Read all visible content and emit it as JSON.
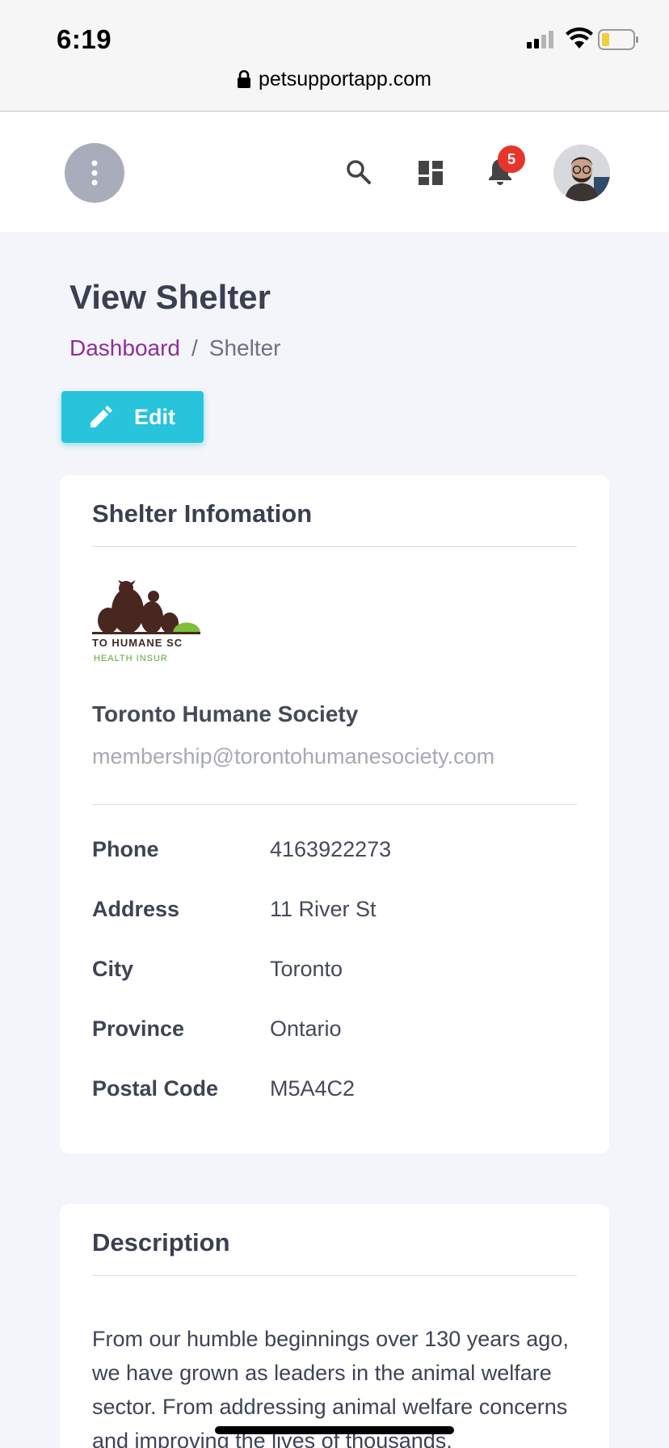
{
  "status_bar": {
    "time": "6:19",
    "url": "petsupportapp.com"
  },
  "header": {
    "menu_icon": "more-vertical-icon",
    "icons": [
      "search-icon",
      "dashboard-icon",
      "bell-icon"
    ],
    "notification_count": "5",
    "avatar_icon": "user-avatar"
  },
  "page": {
    "title": "View Shelter",
    "breadcrumb": {
      "link": "Dashboard",
      "separator": "/",
      "current": "Shelter"
    },
    "edit_label": "Edit"
  },
  "shelter_card": {
    "title": "Shelter Infomation",
    "logo_text_line1": "TO HUMANE SC",
    "logo_text_line2": "HEALTH INSUR",
    "name": "Toronto Humane Society",
    "email": "membership@torontohumanesociety.com",
    "details": [
      {
        "label": "Phone",
        "value": "4163922273"
      },
      {
        "label": "Address",
        "value": "11 River St"
      },
      {
        "label": "City",
        "value": "Toronto"
      },
      {
        "label": "Province",
        "value": "Ontario"
      },
      {
        "label": "Postal Code",
        "value": "M5A4C2"
      }
    ]
  },
  "description_card": {
    "title": "Description",
    "text": "From our humble beginnings over 130 years ago, we have grown as leaders in the animal welfare sector. From addressing animal welfare concerns and improving the lives of thousands,"
  },
  "colors": {
    "accent_link": "#8e2f9c",
    "edit_button": "#27c4dc",
    "badge": "#e8352c",
    "background": "#f4f5fa"
  }
}
